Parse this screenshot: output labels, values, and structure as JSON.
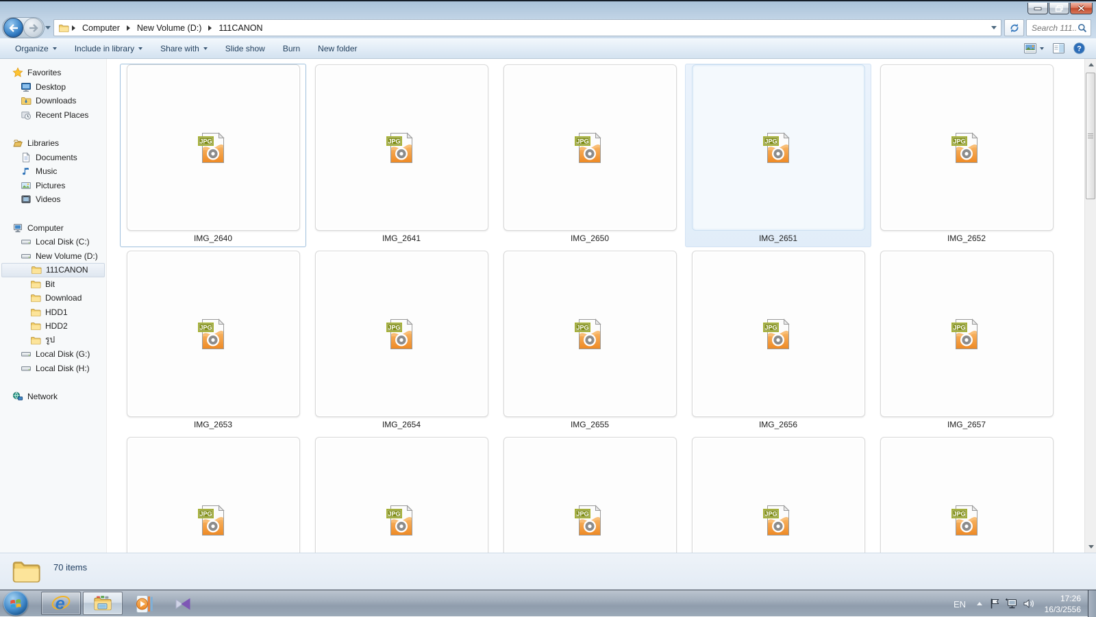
{
  "breadcrumb": {
    "items": [
      "Computer",
      "New Volume (D:)",
      "111CANON"
    ]
  },
  "search": {
    "placeholder": "Search 111..."
  },
  "toolbar": {
    "items": [
      {
        "label": "Organize",
        "dropdown": true
      },
      {
        "label": "Include in library",
        "dropdown": true
      },
      {
        "label": "Share with",
        "dropdown": true
      },
      {
        "label": "Slide show",
        "dropdown": false
      },
      {
        "label": "Burn",
        "dropdown": false
      },
      {
        "label": "New folder",
        "dropdown": false
      }
    ]
  },
  "sidebar": {
    "items": [
      {
        "label": "Favorites"
      },
      {
        "label": "Desktop"
      },
      {
        "label": "Downloads"
      },
      {
        "label": "Recent Places"
      },
      {
        "label": "Libraries"
      },
      {
        "label": "Documents"
      },
      {
        "label": "Music"
      },
      {
        "label": "Pictures"
      },
      {
        "label": "Videos"
      },
      {
        "label": "Computer"
      },
      {
        "label": "Local Disk (C:)"
      },
      {
        "label": "New Volume (D:)"
      },
      {
        "label": "111CANON",
        "selected": true
      },
      {
        "label": "Bit"
      },
      {
        "label": "Download"
      },
      {
        "label": "HDD1"
      },
      {
        "label": "HDD2"
      },
      {
        "label": "รูป"
      },
      {
        "label": "Local Disk (G:)"
      },
      {
        "label": "Local Disk (H:)"
      },
      {
        "label": "Network"
      }
    ]
  },
  "files": {
    "badge": "JPG",
    "items": [
      {
        "label": "IMG_2640",
        "state": "focused"
      },
      {
        "label": "IMG_2641"
      },
      {
        "label": "IMG_2650"
      },
      {
        "label": "IMG_2651",
        "state": "selected"
      },
      {
        "label": "IMG_2652"
      },
      {
        "label": "IMG_2653"
      },
      {
        "label": "IMG_2654"
      },
      {
        "label": "IMG_2655"
      },
      {
        "label": "IMG_2656"
      },
      {
        "label": "IMG_2657"
      },
      {
        "label": ""
      },
      {
        "label": ""
      },
      {
        "label": ""
      },
      {
        "label": ""
      },
      {
        "label": ""
      }
    ]
  },
  "statusbar": {
    "text": "70 items"
  },
  "tray": {
    "lang": "EN",
    "time": "17:26",
    "date": "16/3/2556"
  },
  "icons": {
    "help_glyph": "?",
    "ie_glyph": "e"
  },
  "colors": {
    "selection_fill": "#e9f2fb",
    "selection_border": "#d3e3f4",
    "focus_border": "#9fc0dd",
    "jpg_badge_green": "#7e8c14",
    "jpg_orange": "#ef8b25",
    "taskbar_gray": "#97a4b3",
    "close_red": "#c14a2c"
  }
}
